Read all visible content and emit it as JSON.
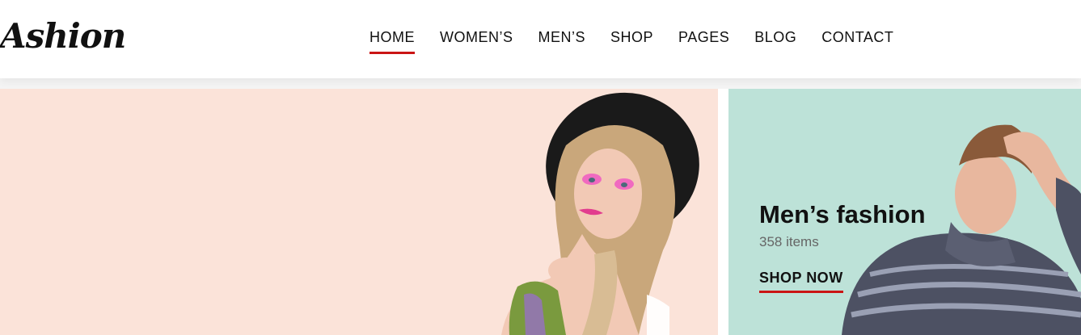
{
  "header": {
    "logo": "Ashion",
    "nav": [
      {
        "label": "HOME",
        "active": true
      },
      {
        "label": "WOMEN’S",
        "active": false
      },
      {
        "label": "MEN’S",
        "active": false
      },
      {
        "label": "SHOP",
        "active": false
      },
      {
        "label": "PAGES",
        "active": false
      },
      {
        "label": "BLOG",
        "active": false
      },
      {
        "label": "CONTACT",
        "active": false
      }
    ]
  },
  "hero_women": {
    "background": "#fbe3d9"
  },
  "hero_men": {
    "title": "Men’s fashion",
    "items": "358 items",
    "cta": "SHOP NOW",
    "background": "#bde2d8"
  },
  "colors": {
    "accent": "#ca1515",
    "text": "#111111",
    "muted": "#666666"
  }
}
